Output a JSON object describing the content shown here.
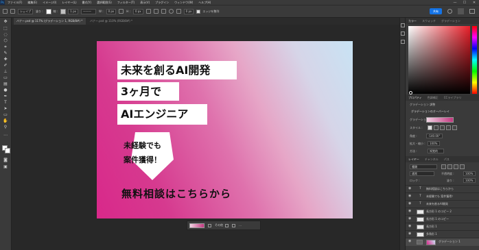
{
  "app": {
    "logo": "Ps",
    "menu": [
      "ファイル(F)",
      "編集(E)",
      "イメージ(I)",
      "レイヤー(L)",
      "書式(Y)",
      "選択範囲(S)",
      "フィルター(T)",
      "表示(V)",
      "プラグイン",
      "ウィンドウ(W)",
      "ヘルプ(H)"
    ],
    "window_controls": [
      "—",
      "☐",
      "✕"
    ]
  },
  "options_bar": {
    "mode": "シェイプ",
    "fill_label": "塗り :",
    "stroke_label": "線 :",
    "stroke_width": "1 px",
    "w_label": "W :",
    "w_value": "0 px",
    "h_label": "H :",
    "h_value": "0 px",
    "radius": "0 px",
    "align_edges": "エッジを整列",
    "share": "共有",
    "fill_color": "#ffffff",
    "stroke_color": "#c0c0c0"
  },
  "tabs": [
    {
      "label": "バナー.psd @ 117% (グラデーション 1, RGB/8#) *"
    },
    {
      "label": "バナー.psd @ 110% (RGB/8#) *"
    }
  ],
  "canvas": {
    "headline1": "未来を創るAI開発",
    "headline2": "3ヶ月で",
    "headline3": "AIエンジニア",
    "badge_line1": "未経験でも",
    "badge_line2": "案件獲得！",
    "cta": "無料相談はこちらから",
    "gradient_colors": [
      "#d9288a",
      "#df72ad",
      "#c8e3f4"
    ]
  },
  "taskbar": {
    "label": "その他"
  },
  "dock": {
    "color_tabs": [
      "カラー",
      "スウォッチ",
      "グラデーション"
    ],
    "props_tabs": [
      "プロパティ",
      "色調補正",
      "CCライブラリ"
    ],
    "props_layer": "グラデーション 調整",
    "props_section": "グラデーションのオーバーレイ",
    "props_gradient_label": "グラデーション :",
    "props_style_label": "スタイル :",
    "props_angle_label": "角度 :",
    "props_angle_value": "-140.00°",
    "props_scale_label": "拡大・縮小 :",
    "props_scale_value": "100%",
    "props_method_label": "方法 :",
    "props_method_value": "知覚的",
    "layers_tabs": [
      "レイヤー",
      "チャンネル",
      "パス"
    ],
    "layers_kind": "種類",
    "layers_mode": "通常",
    "layers_opacity_label": "不透明度 :",
    "layers_opacity": "100%",
    "layers_lock_label": "ロック :",
    "layers_fill_label": "塗り :",
    "layers_fill": "100%",
    "layers": [
      {
        "name": "無料相談はこちらから",
        "type": "T"
      },
      {
        "name": "未経験でも 案件獲得！",
        "type": "T"
      },
      {
        "name": "未来を創るAI開発",
        "type": "T"
      },
      {
        "name": "長方形 1 のコピー 2",
        "type": "shape"
      },
      {
        "name": "長方形 1 のコピー",
        "type": "shape"
      },
      {
        "name": "長方形 1",
        "type": "shape"
      },
      {
        "name": "多角形 1",
        "type": "shape"
      },
      {
        "name": "グラデーション 1",
        "type": "gradient"
      }
    ]
  }
}
